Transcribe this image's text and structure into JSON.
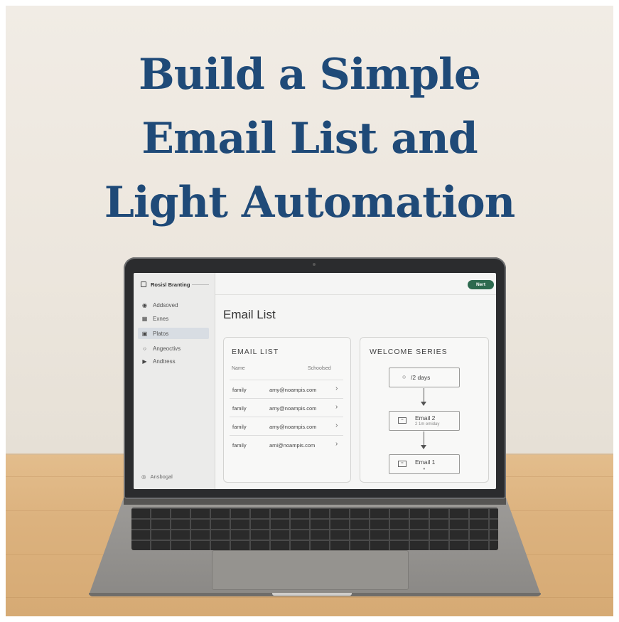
{
  "headline": [
    "Build a Simple",
    "Email List and",
    "Light Automation"
  ],
  "app": {
    "brand": "Rosisl Branting",
    "sidebar": [
      {
        "label": "Addsoved",
        "icon": "badge-icon"
      },
      {
        "label": "Exnes",
        "icon": "grid-icon"
      },
      {
        "label": "Platos",
        "icon": "folder-icon",
        "active": true
      },
      {
        "label": "Angeoctivs",
        "icon": "circle-icon"
      },
      {
        "label": "Andtress",
        "icon": "play-icon"
      }
    ],
    "sidebar_footer": "Ansbogal",
    "top_button": "Nert",
    "page_title": "Email List",
    "email_list": {
      "title": "EMAIL LIST",
      "columns": [
        "Name",
        "Schoolsed"
      ],
      "rows": [
        {
          "name": "family",
          "email": "amy@noampis.com"
        },
        {
          "name": "family",
          "email": "amy@noampis.com"
        },
        {
          "name": "family",
          "email": "amy@noampis.com"
        },
        {
          "name": "family",
          "email": "ami@noampis.com"
        }
      ]
    },
    "welcome_series": {
      "title": "WELCOME SERIES",
      "steps": [
        {
          "title": "/2 days",
          "subtitle": ""
        },
        {
          "title": "Email 2",
          "subtitle": "2 1m emiday"
        },
        {
          "title": "Email 1",
          "subtitle": ""
        }
      ]
    }
  },
  "colors": {
    "headline": "#1f4a78",
    "button": "#2e6a4f",
    "wall": "#ece6dd",
    "table": "#dcb27e"
  }
}
